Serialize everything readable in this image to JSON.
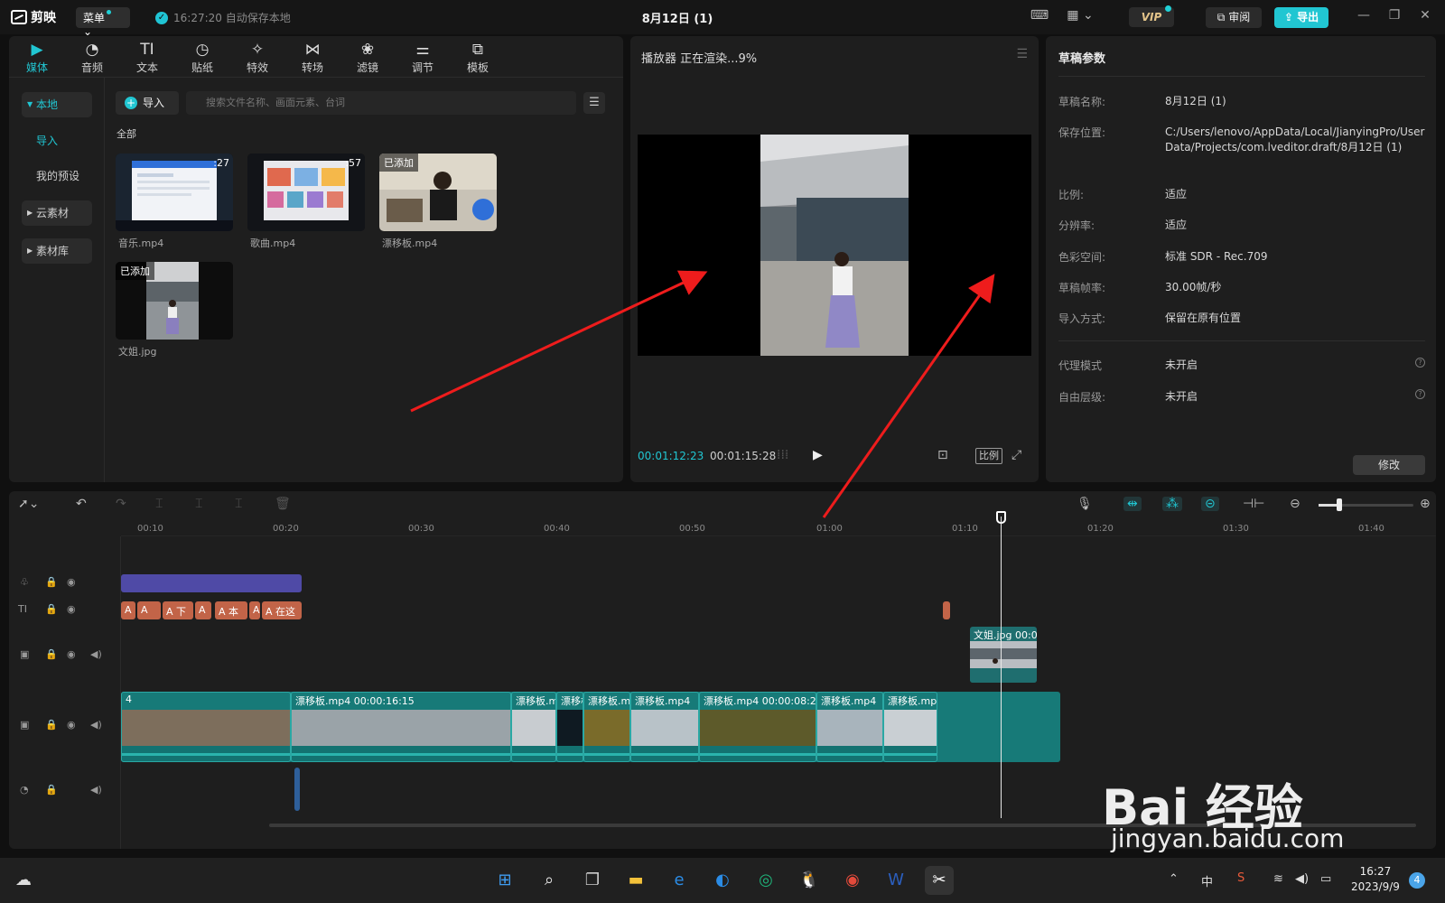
{
  "app": {
    "name": "剪映",
    "menu_label": "菜单",
    "save_status": "16:27:20 自动保存本地",
    "doc_title": "8月12日 (1)",
    "vip_label": "VIP",
    "review_label": "审阅",
    "export_label": "导出",
    "accent": "#21c6d2"
  },
  "toolbar": {
    "tools": [
      {
        "label": "媒体",
        "icon": "media-icon"
      },
      {
        "label": "音频",
        "icon": "audio-icon"
      },
      {
        "label": "文本",
        "icon": "text-icon"
      },
      {
        "label": "贴纸",
        "icon": "sticker-icon"
      },
      {
        "label": "特效",
        "icon": "effects-icon"
      },
      {
        "label": "转场",
        "icon": "transition-icon"
      },
      {
        "label": "滤镜",
        "icon": "filter-icon"
      },
      {
        "label": "调节",
        "icon": "adjust-icon"
      },
      {
        "label": "模板",
        "icon": "template-icon"
      }
    ]
  },
  "media": {
    "sidebar": [
      "本地",
      "导入",
      "我的预设",
      "云素材",
      "素材库"
    ],
    "import_label": "导入",
    "search_placeholder": "搜索文件名称、画面元素、台词",
    "all_label": "全部",
    "items": [
      {
        "name": "音乐.mp4",
        "badge": ":27"
      },
      {
        "name": "歌曲.mp4",
        "badge": ":57"
      },
      {
        "name": "漂移板.mp4",
        "badge": "已添加"
      },
      {
        "name": "文姐.jpg",
        "badge": "已添加"
      }
    ]
  },
  "player": {
    "title": "播放器 正在渲染...9%",
    "current_time": "00:01:12:23",
    "total_time": "00:01:15:28",
    "ratio_label": "比例"
  },
  "params": {
    "title": "草稿参数",
    "rows": [
      {
        "label": "草稿名称:",
        "value": "8月12日 (1)"
      },
      {
        "label": "保存位置:",
        "value": "C:/Users/lenovo/AppData/Local/JianyingPro/User Data/Projects/com.lveditor.draft/8月12日 (1)"
      },
      {
        "label": "比例:",
        "value": "适应"
      },
      {
        "label": "分辨率:",
        "value": "适应"
      },
      {
        "label": "色彩空间:",
        "value": "标准 SDR - Rec.709"
      },
      {
        "label": "草稿帧率:",
        "value": "30.00帧/秒"
      },
      {
        "label": "导入方式:",
        "value": "保留在原有位置"
      },
      {
        "label": "代理模式",
        "value": "未开启"
      },
      {
        "label": "自由层级:",
        "value": "未开启"
      }
    ],
    "modify_label": "修改"
  },
  "timeline": {
    "ruler": [
      "00:10",
      "00:20",
      "00:30",
      "00:40",
      "00:50",
      "01:00",
      "01:10",
      "01:20",
      "01:30",
      "01:40"
    ],
    "text_clips": [
      "A",
      "A",
      "A 下",
      "A",
      "A 本",
      "A",
      "A 在这"
    ],
    "image_clip": "文姐.jpg  00:0",
    "main_clips": [
      {
        "label": "4"
      },
      {
        "label": "漂移板.mp4   00:00:16:15"
      },
      {
        "label": "漂移板.m"
      },
      {
        "label": "漂移板"
      },
      {
        "label": "漂移板.m"
      },
      {
        "label": "漂移板.mp4"
      },
      {
        "label": "漂移板.mp4   00:00:08:25"
      },
      {
        "label": "漂移板.mp4"
      },
      {
        "label": "漂移板.mp"
      }
    ]
  },
  "taskbar": {
    "ime": "中",
    "time": "16:27",
    "date": "2023/9/9",
    "notifications": "4"
  },
  "watermark": {
    "brand": "Bai  经验",
    "url": "jingyan.baidu.com"
  }
}
